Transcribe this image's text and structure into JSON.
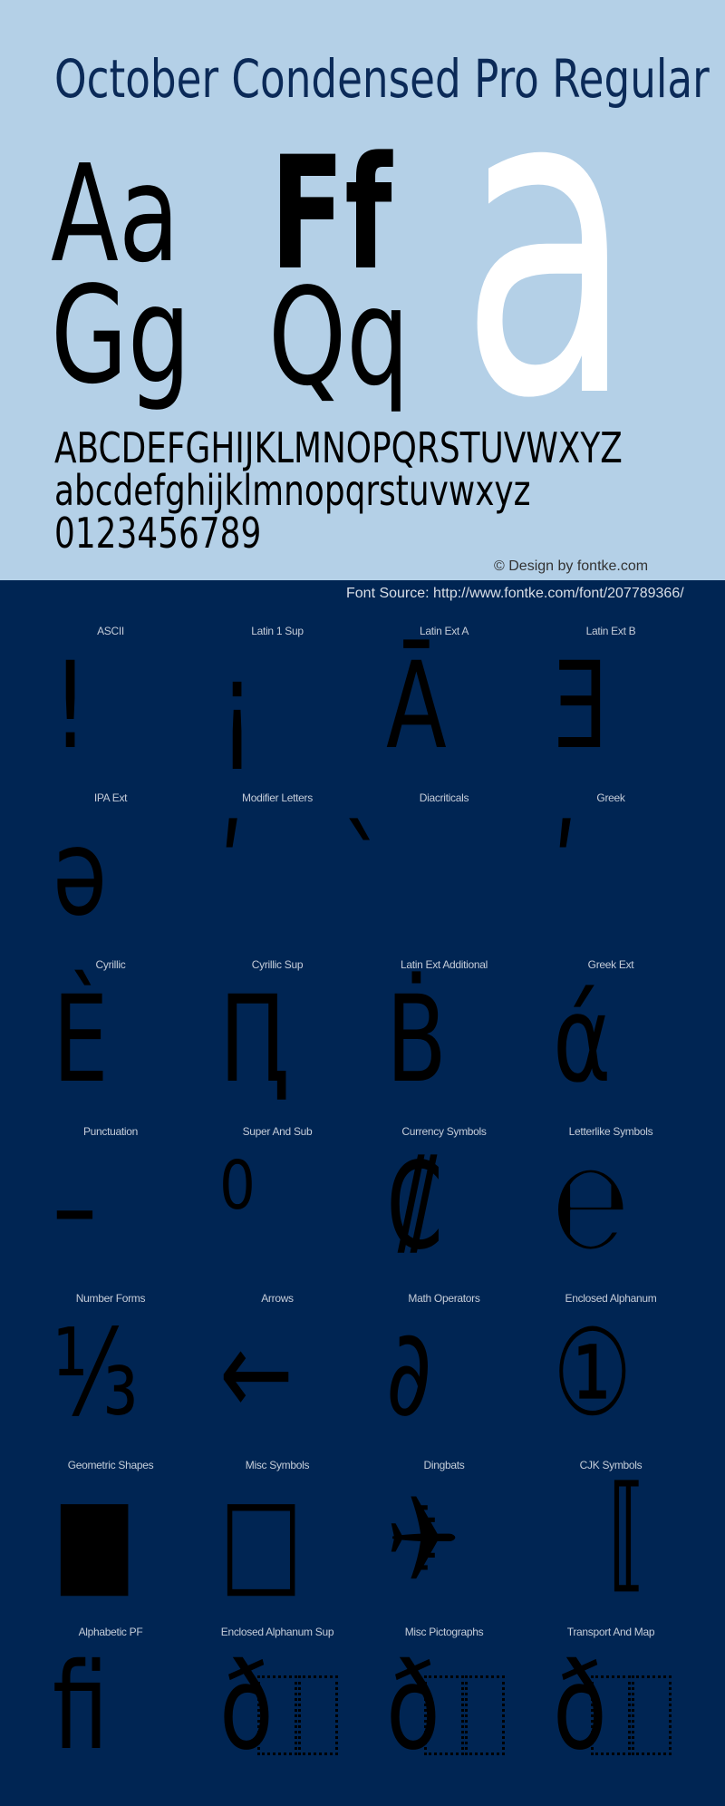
{
  "header": {
    "title": "October Condensed Pro Regular",
    "sample_pairs": [
      "Aa",
      "Ff",
      "Gg",
      "Qq"
    ],
    "big_glyph": "a",
    "uppercase": "ABCDEFGHIJKLMNOPQRSTUVWXYZ",
    "lowercase": "abcdefghijklmnopqrstuvwxyz",
    "digits": "0123456789",
    "credit": "© Design by fontke.com",
    "source": "Font Source: http://www.fontke.com/font/207789366/"
  },
  "colors": {
    "hero_background": "#b4d0e7",
    "page_background": "#002553",
    "title": "#0b2a58",
    "big_glyph": "#ffffff",
    "glyph": "#000000",
    "label": "#c5cdd9"
  },
  "blocks": [
    {
      "label": "ASCII",
      "glyph": "!"
    },
    {
      "label": "Latin 1 Sup",
      "glyph": "¡"
    },
    {
      "label": "Latin Ext A",
      "glyph": "Ā"
    },
    {
      "label": "Latin Ext B",
      "glyph": "Ǝ"
    },
    {
      "label": "IPA Ext",
      "glyph": "ə"
    },
    {
      "label": "Modifier Letters",
      "glyph": "ʹ"
    },
    {
      "label": "Diacriticals",
      "glyph": "̀"
    },
    {
      "label": "Greek",
      "glyph": "ʹ"
    },
    {
      "label": "Cyrillic",
      "glyph": "Ѐ"
    },
    {
      "label": "Cyrillic Sup",
      "glyph": "Ԥ"
    },
    {
      "label": "Latin Ext Additional",
      "glyph": "Ḃ"
    },
    {
      "label": "Greek Ext",
      "glyph": "ά"
    },
    {
      "label": "Punctuation",
      "glyph": "–"
    },
    {
      "label": "Super And Sub",
      "glyph": "⁰"
    },
    {
      "label": "Currency Symbols",
      "glyph": "₡"
    },
    {
      "label": "Letterlike Symbols",
      "glyph": "℮"
    },
    {
      "label": "Number Forms",
      "glyph": "⅓"
    },
    {
      "label": "Arrows",
      "glyph": "←"
    },
    {
      "label": "Math Operators",
      "glyph": "∂"
    },
    {
      "label": "Enclosed Alphanum",
      "glyph": "①"
    },
    {
      "label": "Geometric Shapes",
      "glyph": "■"
    },
    {
      "label": "Misc Symbols",
      "glyph": "□"
    },
    {
      "label": "Dingbats",
      "glyph": "✈"
    },
    {
      "label": "CJK Symbols",
      "glyph": "〚"
    },
    {
      "label": "Alphabetic PF",
      "glyph": "ﬁ"
    },
    {
      "label": "Enclosed Alphanum Sup",
      "glyph": "ð"
    },
    {
      "label": "Misc Pictographs",
      "glyph": "ð"
    },
    {
      "label": "Transport And Map",
      "glyph": "ð"
    }
  ]
}
